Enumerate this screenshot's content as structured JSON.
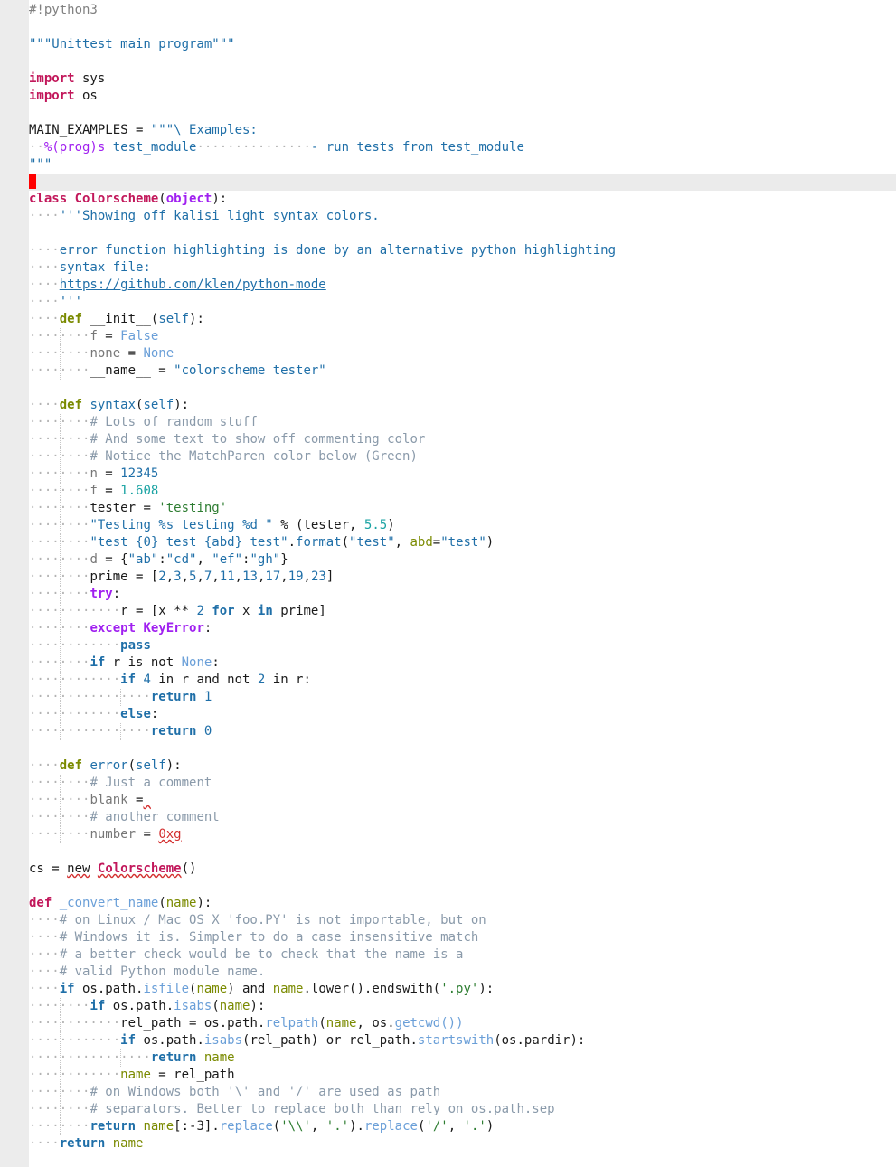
{
  "editor": {
    "lines": [
      [
        {
          "t": "#!python3",
          "c": "sh"
        }
      ],
      [],
      [
        {
          "t": "\"\"\"Unittest main program\"\"\"",
          "c": "doc"
        }
      ],
      [],
      [
        {
          "t": "import",
          "c": "kw"
        },
        {
          "t": " sys"
        }
      ],
      [
        {
          "t": "import",
          "c": "kw"
        },
        {
          "t": " os"
        }
      ],
      [],
      [
        {
          "t": "MAIN_EXAMPLES = "
        },
        {
          "t": "\"\"\"\\ Examples:",
          "c": "doc"
        }
      ],
      [
        {
          "t": "··",
          "c": "ws"
        },
        {
          "t": "%(prog)s",
          "c": "fmt"
        },
        {
          "t": " test_module",
          "c": "doc"
        },
        {
          "t": "···············",
          "c": "ws"
        },
        {
          "t": "- run tests from test_module",
          "c": "doc"
        }
      ],
      [
        {
          "t": "\"\"\"",
          "c": "doc"
        }
      ],
      [],
      [
        {
          "t": "class",
          "c": "kw"
        },
        {
          "t": " "
        },
        {
          "t": "Colorscheme",
          "c": "cname"
        },
        {
          "t": "("
        },
        {
          "t": "object",
          "c": "kwp"
        },
        {
          "t": "):"
        }
      ],
      [
        {
          "t": "····",
          "c": "ws"
        },
        {
          "t": "'''Showing off kalisi light syntax colors.",
          "c": "doc"
        }
      ],
      [],
      [
        {
          "t": "····",
          "c": "ws"
        },
        {
          "t": "error function highlighting is done by an alternative python highlighting",
          "c": "doc"
        }
      ],
      [
        {
          "t": "····",
          "c": "ws"
        },
        {
          "t": "syntax file:",
          "c": "doc"
        }
      ],
      [
        {
          "t": "····",
          "c": "ws"
        },
        {
          "t": "https://github.com/klen/python-mode",
          "c": "url"
        }
      ],
      [
        {
          "t": "····",
          "c": "ws"
        },
        {
          "t": "'''",
          "c": "doc"
        }
      ],
      [
        {
          "t": "····",
          "c": "ws"
        },
        {
          "t": "def",
          "c": "kw2"
        },
        {
          "t": " __init__("
        },
        {
          "t": "self",
          "c": "self"
        },
        {
          "t": "):"
        }
      ],
      [
        {
          "t": "········",
          "c": "ws"
        },
        {
          "t": "f",
          "c": "dim"
        },
        {
          "t": " = "
        },
        {
          "t": "False",
          "c": "const"
        }
      ],
      [
        {
          "t": "········",
          "c": "ws"
        },
        {
          "t": "none",
          "c": "dim"
        },
        {
          "t": " = "
        },
        {
          "t": "None",
          "c": "const"
        }
      ],
      [
        {
          "t": "········",
          "c": "ws"
        },
        {
          "t": "__name__ = "
        },
        {
          "t": "\"colorscheme tester\"",
          "c": "str"
        }
      ],
      [],
      [
        {
          "t": "····",
          "c": "ws"
        },
        {
          "t": "def",
          "c": "kw2"
        },
        {
          "t": " "
        },
        {
          "t": "syntax",
          "c": "fn"
        },
        {
          "t": "("
        },
        {
          "t": "self",
          "c": "self"
        },
        {
          "t": "):"
        }
      ],
      [
        {
          "t": "········",
          "c": "ws"
        },
        {
          "t": "# Lots of random stuff",
          "c": "cmt"
        }
      ],
      [
        {
          "t": "········",
          "c": "ws"
        },
        {
          "t": "# And some text to show off commenting color",
          "c": "cmt"
        }
      ],
      [
        {
          "t": "········",
          "c": "ws"
        },
        {
          "t": "# Notice the MatchParen color below (Green)",
          "c": "cmt"
        }
      ],
      [
        {
          "t": "········",
          "c": "ws"
        },
        {
          "t": "n",
          "c": "dim"
        },
        {
          "t": " = "
        },
        {
          "t": "12345",
          "c": "num"
        }
      ],
      [
        {
          "t": "········",
          "c": "ws"
        },
        {
          "t": "f",
          "c": "dim"
        },
        {
          "t": " = "
        },
        {
          "t": "1.608",
          "c": "numc"
        }
      ],
      [
        {
          "t": "········",
          "c": "ws"
        },
        {
          "t": "tester = "
        },
        {
          "t": "'testing'",
          "c": "str2"
        }
      ],
      [
        {
          "t": "········",
          "c": "ws"
        },
        {
          "t": "\"Testing %s testing %d \"",
          "c": "str"
        },
        {
          "t": " % (tester, "
        },
        {
          "t": "5.5",
          "c": "numc"
        },
        {
          "t": ")"
        }
      ],
      [
        {
          "t": "········",
          "c": "ws"
        },
        {
          "t": "\"test {0} test {abd} test\"",
          "c": "str"
        },
        {
          "t": "."
        },
        {
          "t": "format",
          "c": "fn"
        },
        {
          "t": "("
        },
        {
          "t": "\"test\"",
          "c": "str"
        },
        {
          "t": ", "
        },
        {
          "t": "abd",
          "c": "kwarg"
        },
        {
          "t": "="
        },
        {
          "t": "\"test\"",
          "c": "str"
        },
        {
          "t": ")"
        }
      ],
      [
        {
          "t": "········",
          "c": "ws"
        },
        {
          "t": "d",
          "c": "dim"
        },
        {
          "t": " = {"
        },
        {
          "t": "\"ab\"",
          "c": "str"
        },
        {
          "t": ":"
        },
        {
          "t": "\"cd\"",
          "c": "str"
        },
        {
          "t": ", "
        },
        {
          "t": "\"ef\"",
          "c": "str"
        },
        {
          "t": ":"
        },
        {
          "t": "\"gh\"",
          "c": "str"
        },
        {
          "t": "}"
        }
      ],
      [
        {
          "t": "········",
          "c": "ws"
        },
        {
          "t": "prime = ["
        },
        {
          "t": "2",
          "c": "num"
        },
        {
          "t": ","
        },
        {
          "t": "3",
          "c": "num"
        },
        {
          "t": ","
        },
        {
          "t": "5",
          "c": "num"
        },
        {
          "t": ","
        },
        {
          "t": "7",
          "c": "num"
        },
        {
          "t": ","
        },
        {
          "t": "11",
          "c": "num"
        },
        {
          "t": ","
        },
        {
          "t": "13",
          "c": "num"
        },
        {
          "t": ","
        },
        {
          "t": "17",
          "c": "num"
        },
        {
          "t": ","
        },
        {
          "t": "19",
          "c": "num"
        },
        {
          "t": ","
        },
        {
          "t": "23",
          "c": "num"
        },
        {
          "t": "]"
        }
      ],
      [
        {
          "t": "········",
          "c": "ws"
        },
        {
          "t": "try",
          "c": "kwp"
        },
        {
          "t": ":"
        }
      ],
      [
        {
          "t": "············",
          "c": "ws"
        },
        {
          "t": "r = [x ** "
        },
        {
          "t": "2",
          "c": "num"
        },
        {
          "t": " "
        },
        {
          "t": "for",
          "c": "kw3"
        },
        {
          "t": " x "
        },
        {
          "t": "in",
          "c": "kw3"
        },
        {
          "t": " prime]"
        }
      ],
      [
        {
          "t": "········",
          "c": "ws"
        },
        {
          "t": "except",
          "c": "kwp"
        },
        {
          "t": " "
        },
        {
          "t": "KeyError",
          "c": "cls"
        },
        {
          "t": ":"
        }
      ],
      [
        {
          "t": "············",
          "c": "ws"
        },
        {
          "t": "pass",
          "c": "kw3"
        }
      ],
      [
        {
          "t": "········",
          "c": "ws"
        },
        {
          "t": "if",
          "c": "kw3"
        },
        {
          "t": " r is not "
        },
        {
          "t": "None",
          "c": "const"
        },
        {
          "t": ":"
        }
      ],
      [
        {
          "t": "············",
          "c": "ws"
        },
        {
          "t": "if",
          "c": "kw3"
        },
        {
          "t": " "
        },
        {
          "t": "4",
          "c": "num"
        },
        {
          "t": " in r and not "
        },
        {
          "t": "2",
          "c": "num"
        },
        {
          "t": " in r:"
        }
      ],
      [
        {
          "t": "················",
          "c": "ws"
        },
        {
          "t": "return",
          "c": "kw3"
        },
        {
          "t": " "
        },
        {
          "t": "1",
          "c": "num"
        }
      ],
      [
        {
          "t": "············",
          "c": "ws"
        },
        {
          "t": "else",
          "c": "kw3"
        },
        {
          "t": ":"
        }
      ],
      [
        {
          "t": "················",
          "c": "ws"
        },
        {
          "t": "return",
          "c": "kw3"
        },
        {
          "t": " "
        },
        {
          "t": "0",
          "c": "num"
        }
      ],
      [],
      [
        {
          "t": "····",
          "c": "ws"
        },
        {
          "t": "def",
          "c": "kw2"
        },
        {
          "t": " "
        },
        {
          "t": "error",
          "c": "fn"
        },
        {
          "t": "("
        },
        {
          "t": "self",
          "c": "self"
        },
        {
          "t": "):"
        }
      ],
      [
        {
          "t": "········",
          "c": "ws"
        },
        {
          "t": "# Just a comment",
          "c": "cmt"
        }
      ],
      [
        {
          "t": "········",
          "c": "ws"
        },
        {
          "t": "blank",
          "c": "dim"
        },
        {
          "t": " ="
        },
        {
          "t": " ",
          "c": "errp"
        }
      ],
      [
        {
          "t": "········",
          "c": "ws"
        },
        {
          "t": "# another comment",
          "c": "cmt"
        }
      ],
      [
        {
          "t": "········",
          "c": "ws"
        },
        {
          "t": "number",
          "c": "dim"
        },
        {
          "t": " = "
        },
        {
          "t": "0xg",
          "c": "err"
        }
      ],
      [],
      [
        {
          "t": "cs = "
        },
        {
          "t": "new",
          "c": "errp"
        },
        {
          "t": " "
        },
        {
          "t": "Colorscheme",
          "c": "err2"
        },
        {
          "t": "()"
        }
      ],
      [],
      [
        {
          "t": "def",
          "c": "kw"
        },
        {
          "t": " "
        },
        {
          "t": "_convert_name",
          "c": "fnl"
        },
        {
          "t": "("
        },
        {
          "t": "name",
          "c": "kwarg"
        },
        {
          "t": "):"
        }
      ],
      [
        {
          "t": "····",
          "c": "ws"
        },
        {
          "t": "# on Linux / Mac OS X 'foo.PY' is not importable, but on",
          "c": "cmt"
        }
      ],
      [
        {
          "t": "····",
          "c": "ws"
        },
        {
          "t": "# Windows it is. Simpler to do a case insensitive match",
          "c": "cmt"
        }
      ],
      [
        {
          "t": "····",
          "c": "ws"
        },
        {
          "t": "# a better check would be to check that the name is a",
          "c": "cmt"
        }
      ],
      [
        {
          "t": "····",
          "c": "ws"
        },
        {
          "t": "# valid Python module name.",
          "c": "cmt"
        }
      ],
      [
        {
          "t": "····",
          "c": "ws"
        },
        {
          "t": "if",
          "c": "kw3"
        },
        {
          "t": " os.path."
        },
        {
          "t": "isfile",
          "c": "bi"
        },
        {
          "t": "("
        },
        {
          "t": "name",
          "c": "kwarg"
        },
        {
          "t": ") and "
        },
        {
          "t": "name",
          "c": "kwarg"
        },
        {
          "t": ".lower().endswith("
        },
        {
          "t": "'.py'",
          "c": "str2"
        },
        {
          "t": "):"
        }
      ],
      [
        {
          "t": "········",
          "c": "ws"
        },
        {
          "t": "if",
          "c": "kw3"
        },
        {
          "t": " os.path."
        },
        {
          "t": "isabs",
          "c": "bi"
        },
        {
          "t": "("
        },
        {
          "t": "name",
          "c": "kwarg"
        },
        {
          "t": "):"
        }
      ],
      [
        {
          "t": "············",
          "c": "ws"
        },
        {
          "t": "rel_path = os.path."
        },
        {
          "t": "relpath",
          "c": "bi"
        },
        {
          "t": "("
        },
        {
          "t": "name",
          "c": "kwarg"
        },
        {
          "t": ", os."
        },
        {
          "t": "getcwd",
          "c": "bi"
        },
        {
          "t": "())",
          "c": "bi"
        }
      ],
      [
        {
          "t": "············",
          "c": "ws"
        },
        {
          "t": "if",
          "c": "kw3"
        },
        {
          "t": " os.path."
        },
        {
          "t": "isabs",
          "c": "bi"
        },
        {
          "t": "(rel_path) or rel_path."
        },
        {
          "t": "startswith",
          "c": "bi"
        },
        {
          "t": "(os.pardir):"
        }
      ],
      [
        {
          "t": "················",
          "c": "ws"
        },
        {
          "t": "return",
          "c": "kw3"
        },
        {
          "t": " "
        },
        {
          "t": "name",
          "c": "kwarg"
        }
      ],
      [
        {
          "t": "············",
          "c": "ws"
        },
        {
          "t": "name",
          "c": "kwarg"
        },
        {
          "t": " = rel_path"
        }
      ],
      [
        {
          "t": "········",
          "c": "ws"
        },
        {
          "t": "# on Windows both '\\' and '/' are used as path",
          "c": "cmt"
        }
      ],
      [
        {
          "t": "········",
          "c": "ws"
        },
        {
          "t": "# separators. Better to replace both than rely on os.path.sep",
          "c": "cmt"
        }
      ],
      [
        {
          "t": "········",
          "c": "ws"
        },
        {
          "t": "return",
          "c": "kw3"
        },
        {
          "t": " "
        },
        {
          "t": "name",
          "c": "kwarg"
        },
        {
          "t": "[:-3]."
        },
        {
          "t": "replace",
          "c": "bi"
        },
        {
          "t": "("
        },
        {
          "t": "'\\\\'",
          "c": "str2"
        },
        {
          "t": ", "
        },
        {
          "t": "'.'",
          "c": "str2"
        },
        {
          "t": ")."
        },
        {
          "t": "replace",
          "c": "bi"
        },
        {
          "t": "("
        },
        {
          "t": "'/'",
          "c": "str2"
        },
        {
          "t": ", "
        },
        {
          "t": "'.'",
          "c": "str2"
        },
        {
          "t": ")"
        }
      ],
      [
        {
          "t": "····",
          "c": "ws"
        },
        {
          "t": "return",
          "c": "kw3"
        },
        {
          "t": " "
        },
        {
          "t": "name",
          "c": "kwarg"
        }
      ]
    ],
    "current_line": 10,
    "colors": {
      "cursor": "#ff0000",
      "gutter": "#ececec",
      "current_line": "#ebebeb"
    }
  }
}
